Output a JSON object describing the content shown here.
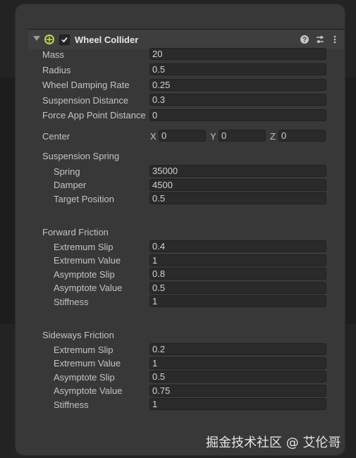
{
  "component": {
    "title": "Wheel Collider",
    "enabled": true,
    "icons": [
      "foldout-arrow-icon",
      "wheel-collider-icon",
      "checkbox-icon",
      "help-icon",
      "preset-icon",
      "kebab-menu-icon"
    ]
  },
  "fields": {
    "mass": {
      "label": "Mass",
      "value": "20"
    },
    "radius": {
      "label": "Radius",
      "value": "0.5"
    },
    "wheel_damping_rate": {
      "label": "Wheel Damping Rate",
      "value": "0.25"
    },
    "suspension_distance": {
      "label": "Suspension Distance",
      "value": "0.3"
    },
    "force_app_point_distance": {
      "label": "Force App Point Distance",
      "value": "0"
    }
  },
  "center": {
    "label": "Center",
    "x_label": "X",
    "x": "0",
    "y_label": "Y",
    "y": "0",
    "z_label": "Z",
    "z": "0"
  },
  "suspension_spring": {
    "label": "Suspension Spring",
    "spring": {
      "label": "Spring",
      "value": "35000"
    },
    "damper": {
      "label": "Damper",
      "value": "4500"
    },
    "target_position": {
      "label": "Target Position",
      "value": "0.5"
    }
  },
  "forward_friction": {
    "label": "Forward Friction",
    "extremum_slip": {
      "label": "Extremum Slip",
      "value": "0.4"
    },
    "extremum_value": {
      "label": "Extremum Value",
      "value": "1"
    },
    "asymptote_slip": {
      "label": "Asymptote Slip",
      "value": "0.8"
    },
    "asymptote_value": {
      "label": "Asymptote Value",
      "value": "0.5"
    },
    "stiffness": {
      "label": "Stiffness",
      "value": "1"
    }
  },
  "sideways_friction": {
    "label": "Sideways Friction",
    "extremum_slip": {
      "label": "Extremum Slip",
      "value": "0.2"
    },
    "extremum_value": {
      "label": "Extremum Value",
      "value": "1"
    },
    "asymptote_slip": {
      "label": "Asymptote Slip",
      "value": "0.5"
    },
    "asymptote_value": {
      "label": "Asymptote Value",
      "value": "0.75"
    },
    "stiffness": {
      "label": "Stiffness",
      "value": "1"
    }
  },
  "watermark": "掘金技术社区 @ 艾伦哥",
  "colors": {
    "panel": "#383838",
    "field": "#2a2a2a",
    "icon_green": "#b7d94a"
  }
}
